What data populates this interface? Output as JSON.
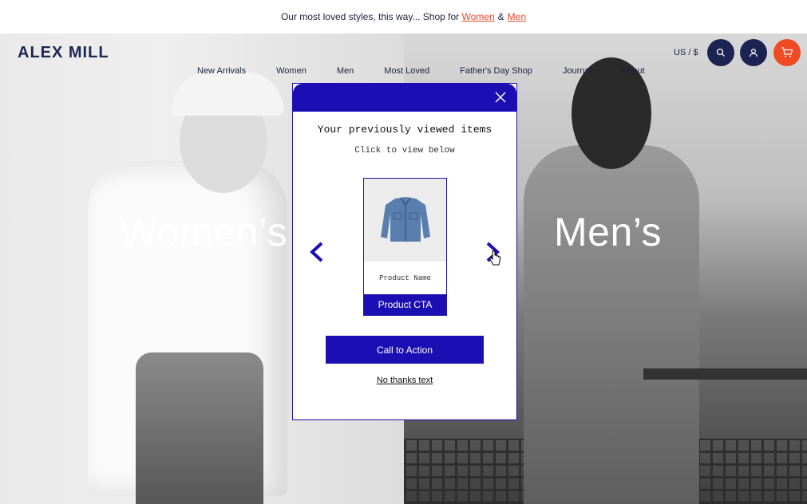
{
  "announcement": {
    "text": "Our most loved styles, this way... Shop for",
    "women_link": "Women",
    "and": "&",
    "men_link": "Men"
  },
  "header": {
    "logo": "ALEX MILL",
    "locale": "US / $",
    "nav": [
      "New Arrivals",
      "Women",
      "Men",
      "Most Loved",
      "Father's Day Shop",
      "Journal",
      "About"
    ]
  },
  "hero": {
    "women_label": "Women’s",
    "men_label": "Men’s"
  },
  "modal": {
    "title": "Your previously viewed items",
    "subtitle": "Click to view below",
    "product_name": "Product Name",
    "product_cta": "Product CTA",
    "cta": "Call to Action",
    "no_thanks": "No thanks text"
  },
  "colors": {
    "brand_blue": "#1b0fb3",
    "navy": "#1b2452",
    "accent_orange": "#ef4a23",
    "link_red": "#e8462b"
  },
  "icons": {
    "search": "search-icon",
    "account": "user-icon",
    "cart": "cart-icon",
    "close": "close-icon",
    "prev": "chevron-left-icon",
    "next": "chevron-right-icon"
  }
}
